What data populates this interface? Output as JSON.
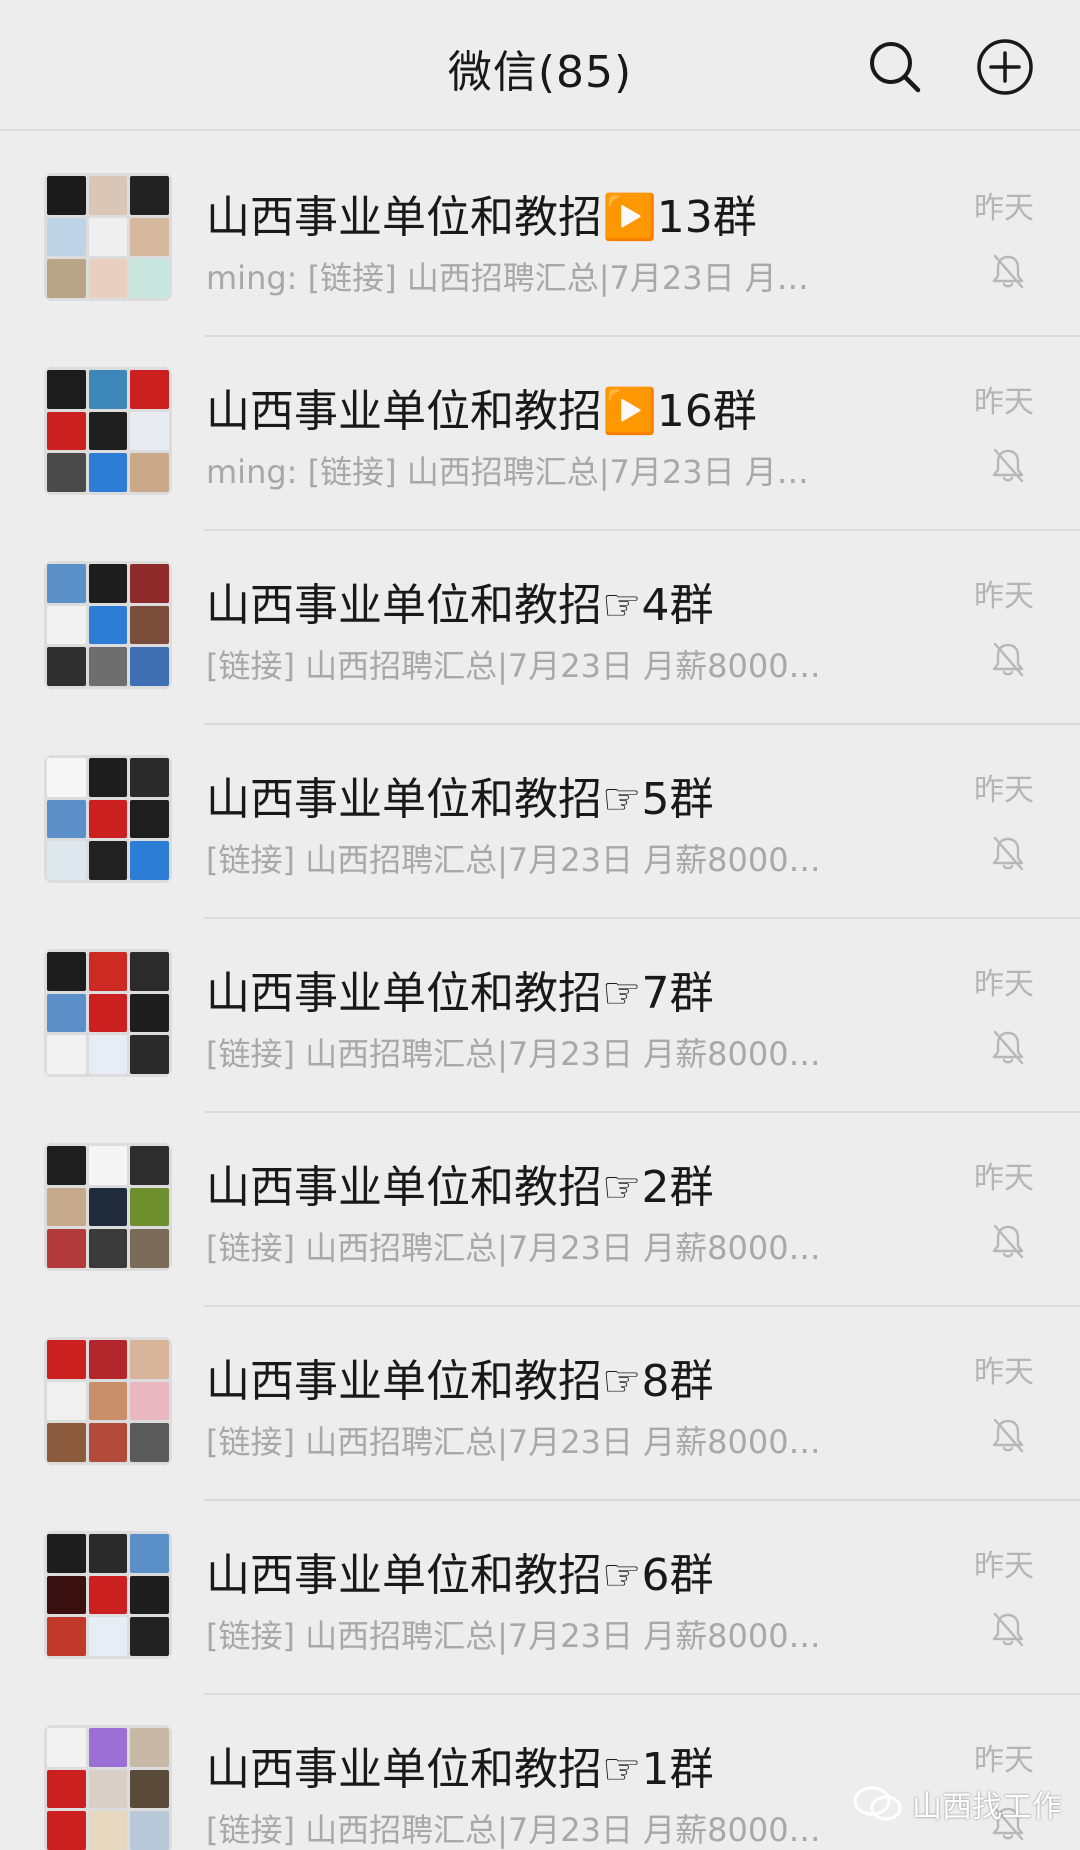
{
  "header": {
    "title": "微信(85)"
  },
  "chats": [
    {
      "name": "山西事业单位和教招▶️13群",
      "preview": "ming: [链接] 山西招聘汇总|7月23日 月…",
      "time": "昨天",
      "tiles": [
        "#1b1b1b",
        "#d9c6b7",
        "#222222",
        "#bfd3e6",
        "#efefef",
        "#d4b79c",
        "#b8a588",
        "#e8cfc0",
        "#c8e6dd"
      ]
    },
    {
      "name": "山西事业单位和教招▶️16群",
      "preview": "ming: [链接] 山西招聘汇总|7月23日 月…",
      "time": "昨天",
      "tiles": [
        "#1c1c1c",
        "#3c86b8",
        "#cc1f1f",
        "#cc1f1f",
        "#1f1f1f",
        "#e8ecf2",
        "#4a4a4a",
        "#2d7cd6",
        "#c9a98a"
      ]
    },
    {
      "name": "山西事业单位和教招☞4群",
      "preview": "[链接] 山西招聘汇总|7月23日 月薪8000…",
      "time": "昨天",
      "tiles": [
        "#5a8fc7",
        "#1d1d1d",
        "#8e2a2a",
        "#f2f2f2",
        "#2d7cd6",
        "#7a4e3a",
        "#2f2f2f",
        "#6e6e6e",
        "#3f6fb3"
      ]
    },
    {
      "name": "山西事业单位和教招☞5群",
      "preview": "[链接] 山西招聘汇总|7月23日 月薪8000…",
      "time": "昨天",
      "tiles": [
        "#f7f7f7",
        "#1d1d1d",
        "#2a2a2a",
        "#5a8fc7",
        "#cc1f1f",
        "#1e1e1e",
        "#dfe7ef",
        "#222222",
        "#2d7cd6"
      ]
    },
    {
      "name": "山西事业单位和教招☞7群",
      "preview": "[链接] 山西招聘汇总|7月23日 月薪8000…",
      "time": "昨天",
      "tiles": [
        "#1c1c1c",
        "#cc2a22",
        "#2b2b2b",
        "#5a8fc7",
        "#cc1f1f",
        "#1d1d1d",
        "#f2f2f2",
        "#e6edf4",
        "#2a2a2a"
      ]
    },
    {
      "name": "山西事业单位和教招☞2群",
      "preview": "[链接] 山西招聘汇总|7月23日 月薪8000…",
      "time": "昨天",
      "tiles": [
        "#1e1e1e",
        "#f5f5f5",
        "#2d2d2d",
        "#c6a98a",
        "#1f2a3a",
        "#6f8f2e",
        "#b33a3a",
        "#3a3a3a",
        "#7a6a58"
      ]
    },
    {
      "name": "山西事业单位和教招☞8群",
      "preview": "[链接] 山西招聘汇总|7月23日 月薪8000…",
      "time": "昨天",
      "tiles": [
        "#cc1f1f",
        "#b3262b",
        "#d8b59a",
        "#f0f0f0",
        "#c98f6a",
        "#e9b7c0",
        "#8c5a3c",
        "#b34a3a",
        "#5a5a5a"
      ]
    },
    {
      "name": "山西事业单位和教招☞6群",
      "preview": "[链接] 山西招聘汇总|7月23日 月薪8000…",
      "time": "昨天",
      "tiles": [
        "#1d1d1d",
        "#2a2a2a",
        "#5a8fc7",
        "#3a0f0f",
        "#cc1f1f",
        "#1d1d1d",
        "#c0392b",
        "#e6edf4",
        "#222222"
      ]
    },
    {
      "name": "山西事业单位和教招☞1群",
      "preview": "[链接] 山西招聘汇总|7月23日 月薪8000…",
      "time": "昨天",
      "tiles": [
        "#f2f2f2",
        "#9c6fd6",
        "#c8b8a6",
        "#cc1f1f",
        "#d9cfc6",
        "#5a4a3a",
        "#cc1f1f",
        "#e8d8c0",
        "#b8c8d8"
      ]
    }
  ],
  "watermark": {
    "text": "山西找工作"
  },
  "colors": {
    "background": "#ededed",
    "title": "#191919",
    "preview": "#a8a8a8",
    "divider": "#dadada"
  }
}
